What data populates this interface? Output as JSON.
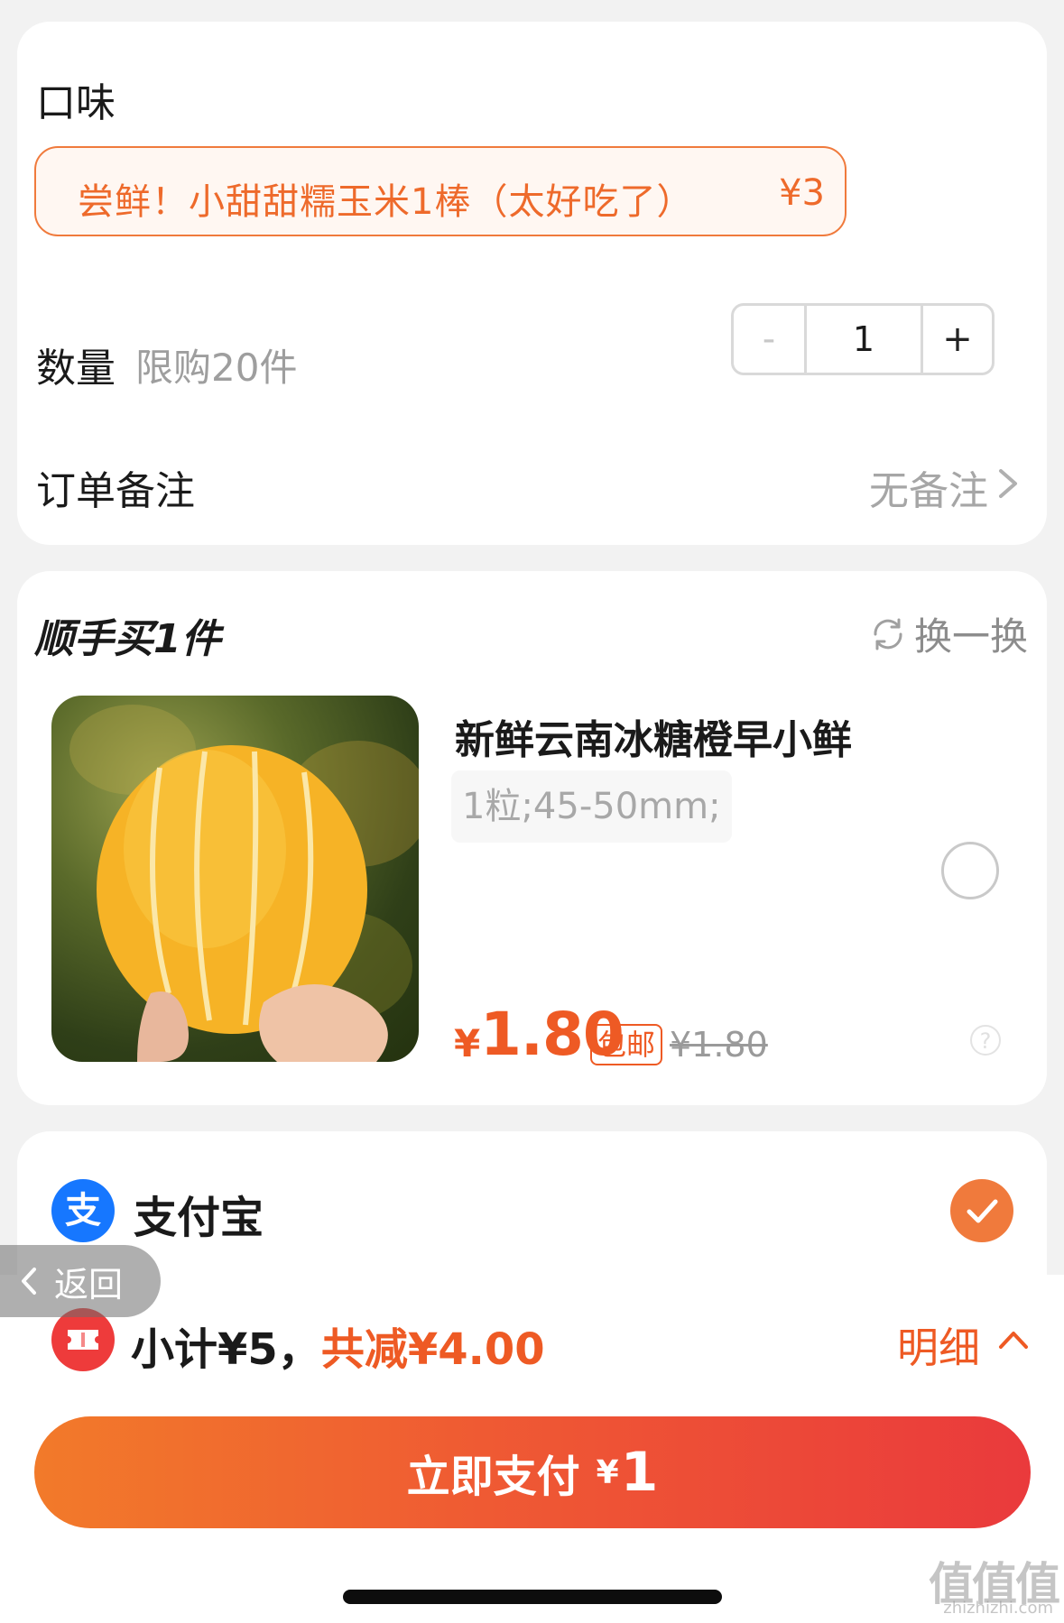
{
  "colors": {
    "accent": "#ee5a24",
    "alipay": "#1677ff",
    "coupon": "#ee3b3b"
  },
  "options": {
    "flavor_label": "口味",
    "flavor_selected": {
      "name": "尝鲜！小甜甜糯玉米1棒（太好吃了）",
      "price": "¥3"
    },
    "quantity_label": "数量",
    "quantity_limit": "限购20件",
    "quantity_minus": "-",
    "quantity_value": "1",
    "quantity_plus": "+",
    "note_label": "订单备注",
    "note_value": "无备注"
  },
  "bundle": {
    "title": "顺手买1件",
    "swap_label": "换一换",
    "product": {
      "name": "新鲜云南冰糖橙早小鲜",
      "spec": "1粒;45-50mm;",
      "price_symbol": "¥",
      "price": "1.80",
      "shipping_tag": "包邮",
      "original_price": "¥1.80",
      "help": "?"
    }
  },
  "payment": {
    "method_label": "支付宝",
    "logo_char": "支"
  },
  "summary": {
    "subtotal": "小计¥5，",
    "discount": "共减¥4.00",
    "detail_label": "明细"
  },
  "pay_button": {
    "label": "立即支付",
    "symbol": "¥",
    "amount": "1"
  },
  "back_button": {
    "label": "返回"
  },
  "watermark": {
    "text": "值值值",
    "sub": "zhizhizhi.com"
  }
}
